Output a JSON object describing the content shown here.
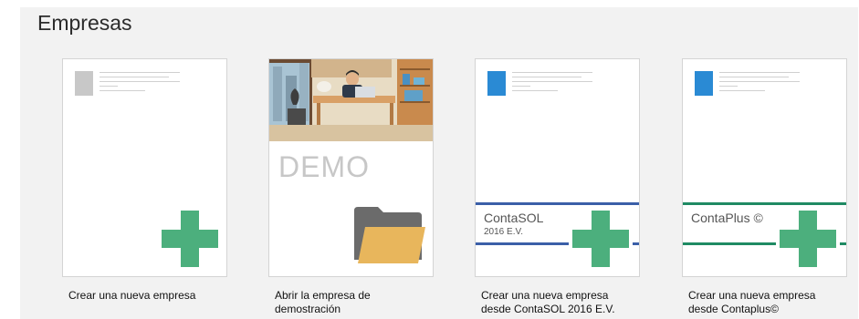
{
  "section_title": "Empresas",
  "tiles": [
    {
      "caption": "Crear una nueva empresa"
    },
    {
      "caption": "Abrir la empresa de\ndemostración",
      "card_text": "DEMO"
    },
    {
      "caption": "Crear una nueva empresa\ndesde ContaSOL 2016 E.V.",
      "brand": "ContaSOL",
      "brand_sub": "2016 E.V."
    },
    {
      "caption": "Crear una nueva empresa\ndesde Contaplus©",
      "brand": "ContaPlus ©"
    }
  ],
  "colors": {
    "plus": "#4caf7d",
    "contasol_accent": "#3b5fa8",
    "contaplus_accent": "#1f8a63",
    "placeholder_gray": "#c8c8c8",
    "doc_blue": "#2a8ad4",
    "folder": "#e8b65c"
  }
}
